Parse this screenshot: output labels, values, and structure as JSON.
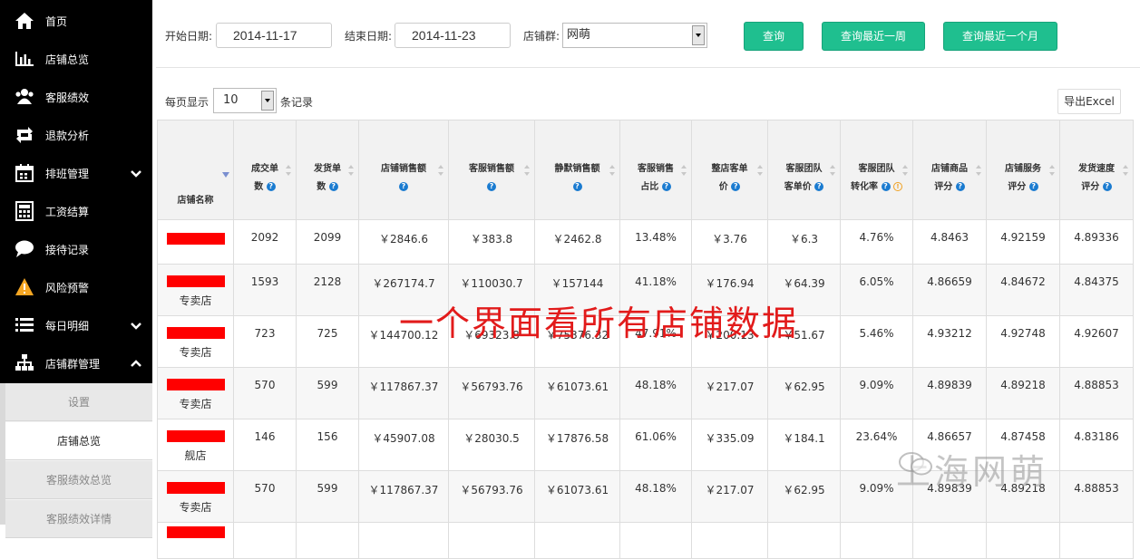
{
  "sidebar": {
    "items": [
      {
        "label": "首页",
        "icon": "home-icon"
      },
      {
        "label": "店铺总览",
        "icon": "bar-chart-icon"
      },
      {
        "label": "客服绩效",
        "icon": "users-icon"
      },
      {
        "label": "退款分析",
        "icon": "retweet-icon"
      },
      {
        "label": "排班管理",
        "icon": "calendar-icon",
        "expand": "down"
      },
      {
        "label": "工资结算",
        "icon": "calculator-icon"
      },
      {
        "label": "接待记录",
        "icon": "chat-icon"
      },
      {
        "label": "风险预警",
        "icon": "warning-icon"
      },
      {
        "label": "每日明细",
        "icon": "list-icon",
        "expand": "down"
      },
      {
        "label": "店铺群管理",
        "icon": "sitemap-icon",
        "expand": "up"
      }
    ],
    "subitems": [
      {
        "label": "设置"
      },
      {
        "label": "店铺总览",
        "active": true
      },
      {
        "label": "客服绩效总览"
      },
      {
        "label": "客服绩效详情"
      }
    ]
  },
  "filters": {
    "start_label": "开始日期:",
    "start_value": "2014-11-17",
    "end_label": "结束日期:",
    "end_value": "2014-11-23",
    "group_label": "店铺群:",
    "group_value": "网萌",
    "query_label": "查询",
    "week_label": "查询最近一周",
    "month_label": "查询最近一个月"
  },
  "paging": {
    "prefix": "每页显示",
    "value": "10",
    "suffix": "条记录",
    "export_label": "导出Excel"
  },
  "table": {
    "columns": [
      {
        "l1": "店铺名称"
      },
      {
        "l1": "成交单",
        "l2": "数",
        "q": true
      },
      {
        "l1": "发货单",
        "l2": "数",
        "q": true
      },
      {
        "l1": "店铺销售额",
        "q": true
      },
      {
        "l1": "客服销售额",
        "q": true
      },
      {
        "l1": "静默销售额",
        "q": true
      },
      {
        "l1": "客服销售",
        "l2": "占比",
        "q": true
      },
      {
        "l1": "整店客单",
        "l2": "价",
        "q": true
      },
      {
        "l1": "客服团队",
        "l2": "客单价",
        "q": true
      },
      {
        "l1": "客服团队",
        "l2": "转化率",
        "q": true,
        "warn": true
      },
      {
        "l1": "店铺商品",
        "l2": "评分",
        "q": true
      },
      {
        "l1": "店铺服务",
        "l2": "评分",
        "q": true
      },
      {
        "l1": "发货速度",
        "l2": "评分",
        "q": true
      }
    ],
    "rows": [
      {
        "store": "",
        "cells": [
          "2092",
          "2099",
          "￥2846.6",
          "￥383.8",
          "￥2462.8",
          "13.48%",
          "￥3.76",
          "￥6.3",
          "4.76%",
          "4.8463",
          "4.92159",
          "4.89336"
        ]
      },
      {
        "store": "专卖店",
        "cells": [
          "1593",
          "2128",
          "￥267174.7",
          "￥110030.7",
          "￥157144",
          "41.18%",
          "￥176.94",
          "￥64.39",
          "6.05%",
          "4.86659",
          "4.84672",
          "4.84375"
        ]
      },
      {
        "store": "专卖店",
        "cells": [
          "723",
          "725",
          "￥144700.12",
          "￥69323.8",
          "￥75376.32",
          "47.91%",
          "￥200.13",
          "￥51.67",
          "5.46%",
          "4.93212",
          "4.92748",
          "4.92607"
        ]
      },
      {
        "store": "专卖店",
        "cells": [
          "570",
          "599",
          "￥117867.37",
          "￥56793.76",
          "￥61073.61",
          "48.18%",
          "￥217.07",
          "￥62.95",
          "9.09%",
          "4.89839",
          "4.89218",
          "4.88853"
        ]
      },
      {
        "store": "舰店",
        "cells": [
          "146",
          "156",
          "￥45907.08",
          "￥28030.5",
          "￥17876.58",
          "61.06%",
          "￥335.09",
          "￥184.1",
          "23.64%",
          "4.86657",
          "4.87458",
          "4.83186"
        ]
      },
      {
        "store": "专卖店",
        "cells": [
          "570",
          "599",
          "￥117867.37",
          "￥56793.76",
          "￥61073.61",
          "48.18%",
          "￥217.07",
          "￥62.95",
          "9.09%",
          "4.89839",
          "4.89218",
          "4.88853"
        ]
      }
    ]
  },
  "overlay_text": "一个界面看所有店铺数据",
  "watermark_text": "上海网萌",
  "colors": {
    "accent": "#1fbf8f",
    "sidebar": "#000000",
    "help": "#1a7bd0",
    "overlay": "#e21b1b"
  }
}
